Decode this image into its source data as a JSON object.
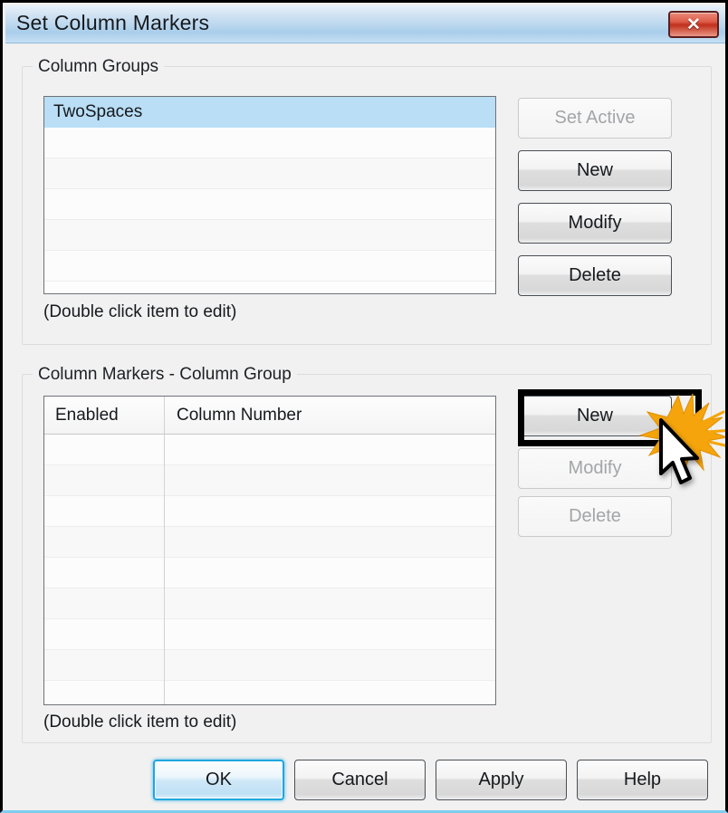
{
  "window": {
    "title": "Set Column Markers",
    "close_label": "✕",
    "close_icon": "close-icon",
    "accent_title_bar": "#b9d6ee",
    "accent_close": "#c02f1c",
    "accent_default_button": "#1fa6de",
    "accent_selection": "#b9def5"
  },
  "column_groups": {
    "legend": "Column Groups",
    "hint": "(Double click item to edit)",
    "items": [
      {
        "label": "TwoSpaces",
        "selected": true
      }
    ],
    "empty_row_count": 5,
    "buttons": [
      {
        "label": "Set Active",
        "enabled": false
      },
      {
        "label": "New",
        "enabled": true
      },
      {
        "label": "Modify",
        "enabled": true
      },
      {
        "label": "Delete",
        "enabled": true
      }
    ]
  },
  "column_markers": {
    "legend": "Column Markers - Column Group",
    "hint": "(Double click item to edit)",
    "columns": [
      {
        "header": "Enabled"
      },
      {
        "header": "Column Number"
      }
    ],
    "rows": [],
    "empty_row_count": 9,
    "buttons": [
      {
        "label": "New",
        "enabled": true,
        "highlighted": true
      },
      {
        "label": "Modify",
        "enabled": false
      },
      {
        "label": "Delete",
        "enabled": false
      }
    ]
  },
  "footer": {
    "buttons": [
      {
        "label": "OK",
        "kind": "default"
      },
      {
        "label": "Cancel",
        "kind": "normal"
      },
      {
        "label": "Apply",
        "kind": "normal"
      },
      {
        "label": "Help",
        "kind": "normal"
      }
    ]
  },
  "annotation": {
    "highlight_target": "New",
    "starburst_color": "#f5a50b",
    "cursor": "mouse-pointer"
  }
}
